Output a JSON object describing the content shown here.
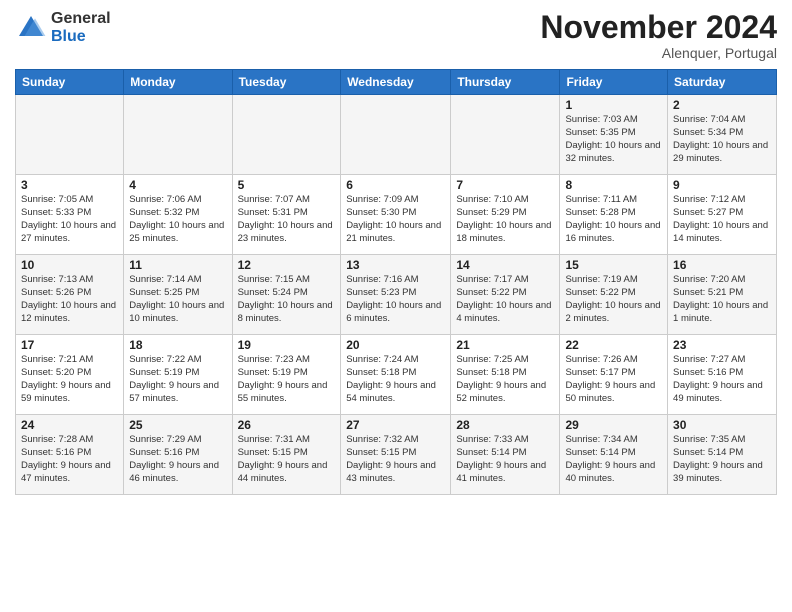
{
  "logo": {
    "general": "General",
    "blue": "Blue"
  },
  "header": {
    "month": "November 2024",
    "location": "Alenquer, Portugal"
  },
  "weekdays": [
    "Sunday",
    "Monday",
    "Tuesday",
    "Wednesday",
    "Thursday",
    "Friday",
    "Saturday"
  ],
  "weeks": [
    [
      {
        "day": "",
        "info": ""
      },
      {
        "day": "",
        "info": ""
      },
      {
        "day": "",
        "info": ""
      },
      {
        "day": "",
        "info": ""
      },
      {
        "day": "",
        "info": ""
      },
      {
        "day": "1",
        "info": "Sunrise: 7:03 AM\nSunset: 5:35 PM\nDaylight: 10 hours and 32 minutes."
      },
      {
        "day": "2",
        "info": "Sunrise: 7:04 AM\nSunset: 5:34 PM\nDaylight: 10 hours and 29 minutes."
      }
    ],
    [
      {
        "day": "3",
        "info": "Sunrise: 7:05 AM\nSunset: 5:33 PM\nDaylight: 10 hours and 27 minutes."
      },
      {
        "day": "4",
        "info": "Sunrise: 7:06 AM\nSunset: 5:32 PM\nDaylight: 10 hours and 25 minutes."
      },
      {
        "day": "5",
        "info": "Sunrise: 7:07 AM\nSunset: 5:31 PM\nDaylight: 10 hours and 23 minutes."
      },
      {
        "day": "6",
        "info": "Sunrise: 7:09 AM\nSunset: 5:30 PM\nDaylight: 10 hours and 21 minutes."
      },
      {
        "day": "7",
        "info": "Sunrise: 7:10 AM\nSunset: 5:29 PM\nDaylight: 10 hours and 18 minutes."
      },
      {
        "day": "8",
        "info": "Sunrise: 7:11 AM\nSunset: 5:28 PM\nDaylight: 10 hours and 16 minutes."
      },
      {
        "day": "9",
        "info": "Sunrise: 7:12 AM\nSunset: 5:27 PM\nDaylight: 10 hours and 14 minutes."
      }
    ],
    [
      {
        "day": "10",
        "info": "Sunrise: 7:13 AM\nSunset: 5:26 PM\nDaylight: 10 hours and 12 minutes."
      },
      {
        "day": "11",
        "info": "Sunrise: 7:14 AM\nSunset: 5:25 PM\nDaylight: 10 hours and 10 minutes."
      },
      {
        "day": "12",
        "info": "Sunrise: 7:15 AM\nSunset: 5:24 PM\nDaylight: 10 hours and 8 minutes."
      },
      {
        "day": "13",
        "info": "Sunrise: 7:16 AM\nSunset: 5:23 PM\nDaylight: 10 hours and 6 minutes."
      },
      {
        "day": "14",
        "info": "Sunrise: 7:17 AM\nSunset: 5:22 PM\nDaylight: 10 hours and 4 minutes."
      },
      {
        "day": "15",
        "info": "Sunrise: 7:19 AM\nSunset: 5:22 PM\nDaylight: 10 hours and 2 minutes."
      },
      {
        "day": "16",
        "info": "Sunrise: 7:20 AM\nSunset: 5:21 PM\nDaylight: 10 hours and 1 minute."
      }
    ],
    [
      {
        "day": "17",
        "info": "Sunrise: 7:21 AM\nSunset: 5:20 PM\nDaylight: 9 hours and 59 minutes."
      },
      {
        "day": "18",
        "info": "Sunrise: 7:22 AM\nSunset: 5:19 PM\nDaylight: 9 hours and 57 minutes."
      },
      {
        "day": "19",
        "info": "Sunrise: 7:23 AM\nSunset: 5:19 PM\nDaylight: 9 hours and 55 minutes."
      },
      {
        "day": "20",
        "info": "Sunrise: 7:24 AM\nSunset: 5:18 PM\nDaylight: 9 hours and 54 minutes."
      },
      {
        "day": "21",
        "info": "Sunrise: 7:25 AM\nSunset: 5:18 PM\nDaylight: 9 hours and 52 minutes."
      },
      {
        "day": "22",
        "info": "Sunrise: 7:26 AM\nSunset: 5:17 PM\nDaylight: 9 hours and 50 minutes."
      },
      {
        "day": "23",
        "info": "Sunrise: 7:27 AM\nSunset: 5:16 PM\nDaylight: 9 hours and 49 minutes."
      }
    ],
    [
      {
        "day": "24",
        "info": "Sunrise: 7:28 AM\nSunset: 5:16 PM\nDaylight: 9 hours and 47 minutes."
      },
      {
        "day": "25",
        "info": "Sunrise: 7:29 AM\nSunset: 5:16 PM\nDaylight: 9 hours and 46 minutes."
      },
      {
        "day": "26",
        "info": "Sunrise: 7:31 AM\nSunset: 5:15 PM\nDaylight: 9 hours and 44 minutes."
      },
      {
        "day": "27",
        "info": "Sunrise: 7:32 AM\nSunset: 5:15 PM\nDaylight: 9 hours and 43 minutes."
      },
      {
        "day": "28",
        "info": "Sunrise: 7:33 AM\nSunset: 5:14 PM\nDaylight: 9 hours and 41 minutes."
      },
      {
        "day": "29",
        "info": "Sunrise: 7:34 AM\nSunset: 5:14 PM\nDaylight: 9 hours and 40 minutes."
      },
      {
        "day": "30",
        "info": "Sunrise: 7:35 AM\nSunset: 5:14 PM\nDaylight: 9 hours and 39 minutes."
      }
    ]
  ]
}
